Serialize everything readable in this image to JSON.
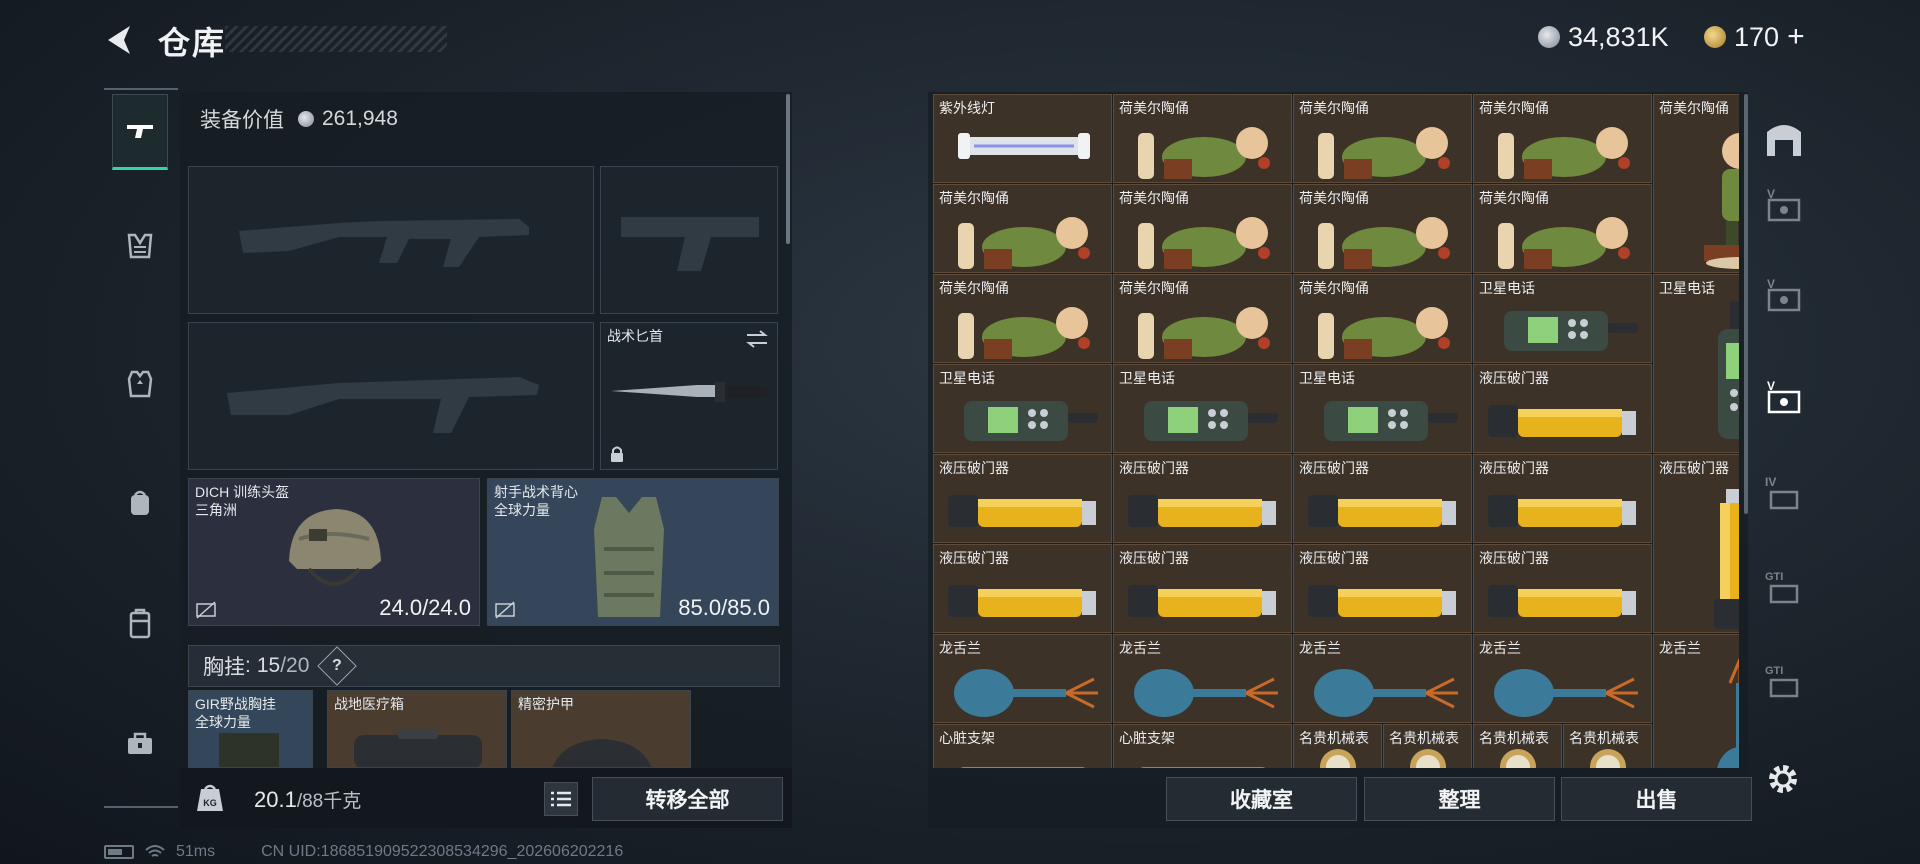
{
  "header": {
    "title": "仓库",
    "currency_silver": "34,831K",
    "currency_gold": "170",
    "gold_plus": "+"
  },
  "equipment": {
    "value_label": "装备价值",
    "value": "261,948",
    "knife_label": "战术匕首",
    "helmet": {
      "name": "DICH 训练头盔",
      "origin": "三角洲",
      "durability": "24.0/24.0"
    },
    "vest": {
      "name": "射手战术背心",
      "origin": "全球力量",
      "durability": "85.0/85.0"
    },
    "chest_rig": {
      "label": "胸挂",
      "colon": ":",
      "used": "15",
      "total": "/20",
      "help": "?"
    },
    "items": [
      {
        "name": "GIR野战胸挂",
        "origin": "全球力量"
      },
      {
        "name": "战地医疗箱",
        "origin": ""
      },
      {
        "name": "精密护甲",
        "origin": ""
      }
    ],
    "weight": "20.1",
    "weight_total": "/88千克",
    "transfer_all": "转移全部"
  },
  "storage": {
    "rows": [
      [
        "紫外线灯",
        "荷美尔陶俑",
        "荷美尔陶俑",
        "荷美尔陶俑",
        "荷美尔陶俑"
      ],
      [
        "荷美尔陶俑",
        "荷美尔陶俑",
        "荷美尔陶俑",
        "荷美尔陶俑"
      ],
      [
        "荷美尔陶俑",
        "荷美尔陶俑",
        "荷美尔陶俑",
        "卫星电话",
        "卫星电话"
      ],
      [
        "卫星电话",
        "卫星电话",
        "卫星电话",
        "液压破门器"
      ],
      [
        "液压破门器",
        "液压破门器",
        "液压破门器",
        "液压破门器",
        "液压破门器"
      ],
      [
        "液压破门器",
        "液压破门器",
        "液压破门器",
        "液压破门器"
      ],
      [
        "龙舌兰",
        "龙舌兰",
        "龙舌兰",
        "龙舌兰",
        "龙舌兰"
      ],
      [
        "心脏支架",
        "心脏支架",
        "名贵机械表",
        "名贵机械表",
        "名贵机械表",
        "名贵机械表"
      ]
    ],
    "buttons": {
      "collection": "收藏室",
      "organize": "整理",
      "sell": "出售"
    }
  },
  "footer": {
    "ping": "51ms",
    "uid": "CN UID:18685190952230853429​6_202606202216"
  },
  "colors": {
    "accent": "#36d3a4",
    "cell_bg": "#3d3227",
    "cell_border": "#5d4c3b"
  }
}
